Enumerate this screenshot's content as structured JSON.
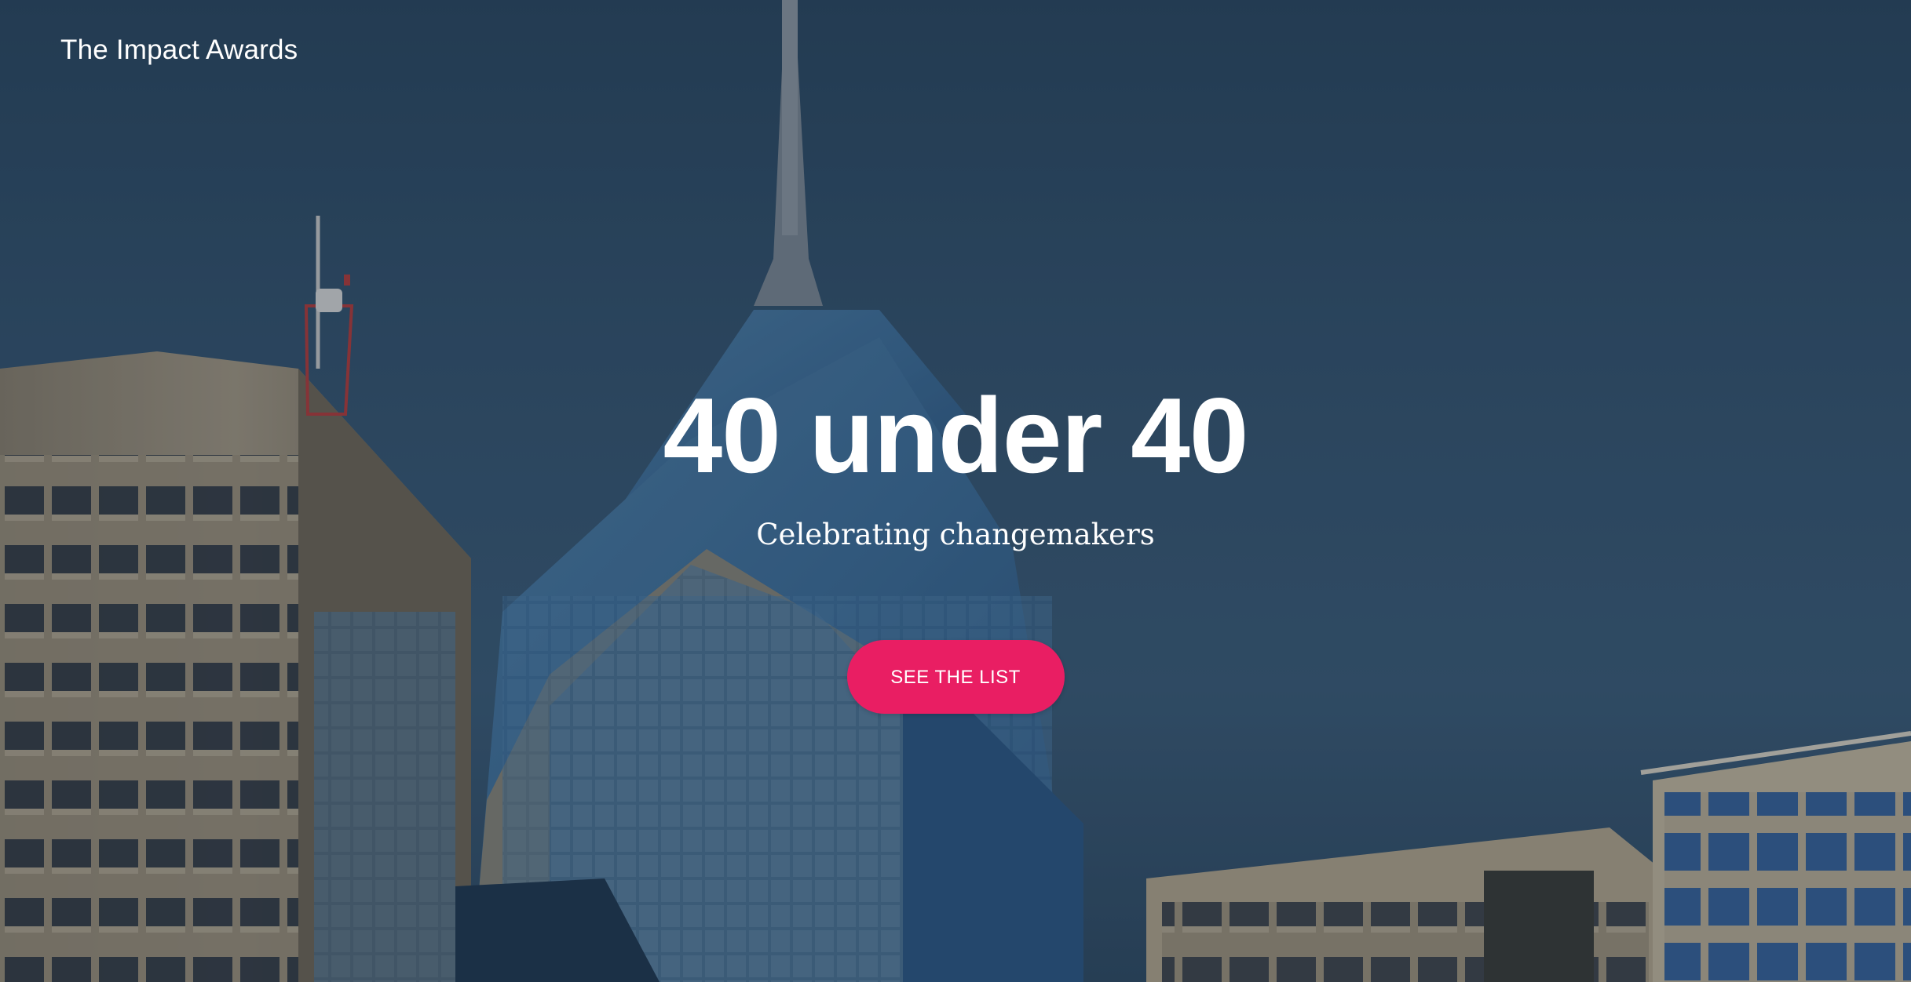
{
  "header": {
    "brand": "The Impact Awards"
  },
  "hero": {
    "title": "40 under 40",
    "subtitle": "Celebrating changemakers",
    "cta_label": "SEE THE LIST",
    "background": "city skyline with glass skyscraper spire",
    "accent_color": "#e91e63"
  }
}
